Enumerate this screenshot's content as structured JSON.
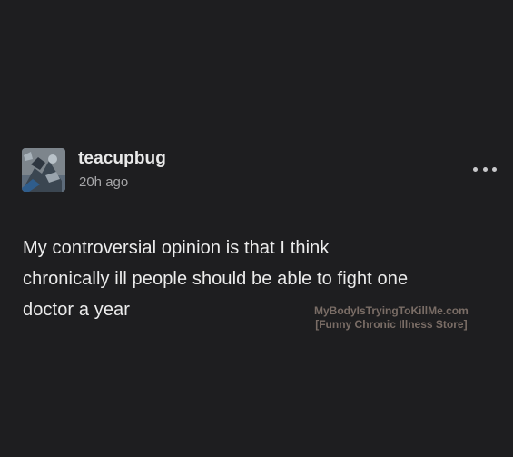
{
  "post": {
    "username": "teacupbug",
    "timestamp": "20h ago",
    "more_icon": "more-horizontal-icon",
    "body_lines": [
      "My controversial opinion is that I think",
      "chronically ill people should be able to fight one",
      "doctor a year"
    ]
  },
  "watermark": {
    "line1": "MyBodyIsTryingToKillMe.com",
    "line2": "[Funny Chronic Illness Store]"
  },
  "colors": {
    "background": "#1e1e20",
    "primary_text": "#ececec",
    "secondary_text": "#a6a6a8",
    "watermark_text": "#7a6d66"
  }
}
